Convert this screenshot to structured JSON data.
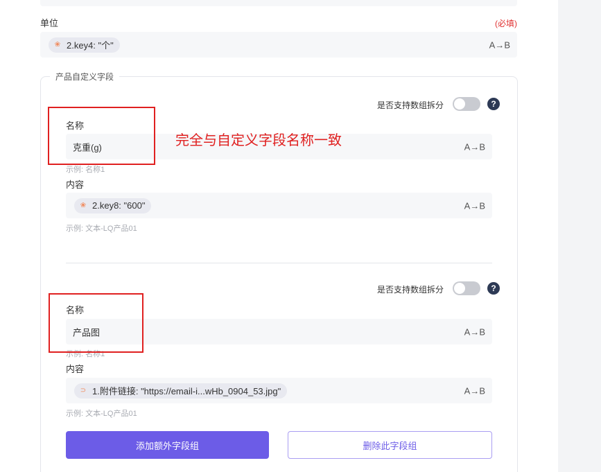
{
  "unit": {
    "label": "单位",
    "required": "(必填)",
    "tag": "2.key4: \"个\"",
    "transform_label": "A→B"
  },
  "custom_fields": {
    "title": "产品自定义字段",
    "groups": [
      {
        "toggle_label": "是否支持数组拆分",
        "toggle_on": false,
        "help": "?",
        "name_label": "名称",
        "name_value": "克重(g)",
        "name_hint": "示例: 名称1",
        "content_label": "内容",
        "content_tag": "2.key8: \"600\"",
        "content_hint": "示例: 文本-LQ产品01",
        "transform_label": "A→B"
      },
      {
        "toggle_label": "是否支持数组拆分",
        "toggle_on": false,
        "help": "?",
        "name_label": "名称",
        "name_value": "产品图",
        "name_hint": "示例: 名称1",
        "content_label": "内容",
        "content_tag": "1.附件链接: \"https://email-i...wHb_0904_53.jpg\"",
        "content_hint": "示例: 文本-LQ产品01",
        "transform_label": "A→B"
      }
    ],
    "add_button": "添加额外字段组",
    "delete_button": "删除此字段组"
  },
  "annotation": "完全与自定义字段名称一致",
  "colors": {
    "primary": "#6c5ce7",
    "annotation": "#e02020"
  }
}
